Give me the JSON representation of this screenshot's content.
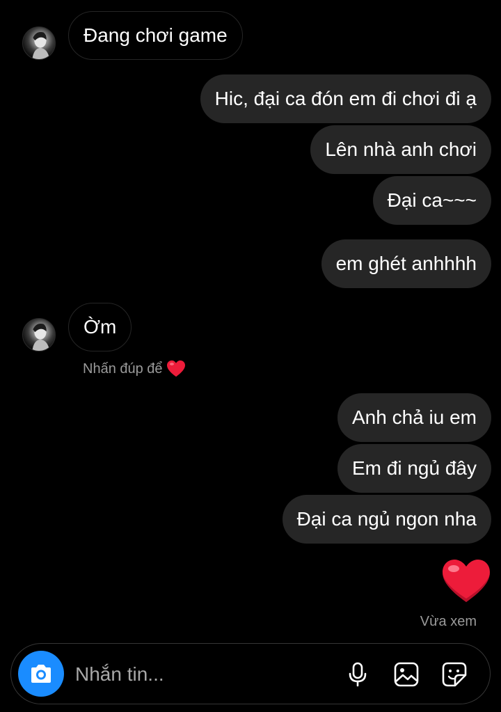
{
  "thread": {
    "messages": [
      {
        "side": "in",
        "text": "Đang chơi game"
      },
      {
        "side": "out",
        "text": "Hic, đại ca đón em đi chơi đi ạ"
      },
      {
        "side": "out",
        "text": "Lên nhà anh chơi"
      },
      {
        "side": "out",
        "text": "Đại ca~~~"
      },
      {
        "side": "out",
        "text": "em ghét anhhhh"
      },
      {
        "side": "in",
        "text": "Ờm"
      },
      {
        "side": "out",
        "text": "Anh chả iu em"
      },
      {
        "side": "out",
        "text": "Em đi ngủ đây"
      },
      {
        "side": "out",
        "text": "Đại ca ngủ ngon nha"
      }
    ],
    "double_tap_hint": "Nhấn đúp để",
    "sent_reaction": "heart-emoji",
    "seen_status": "Vừa xem"
  },
  "composer": {
    "placeholder": "Nhắn tin...",
    "icons": [
      "camera-icon",
      "microphone-icon",
      "gallery-icon",
      "sticker-icon"
    ]
  },
  "colors": {
    "background": "#000000",
    "outgoing_bubble": "#262626",
    "incoming_border": "#262626",
    "secondary_text": "#9a9a9a",
    "camera_button": "#1a8cff",
    "heart": "#ed1c3a"
  }
}
